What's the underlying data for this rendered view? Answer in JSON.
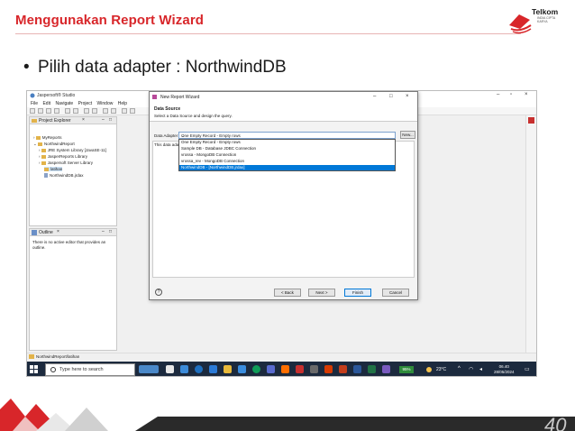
{
  "slide": {
    "title": "Menggunakan Report Wizard",
    "bullet": "Pilih data adapter : NorthwindDB",
    "page_number": "40"
  },
  "logo": {
    "name": "Telkom",
    "subtitle": "INDIA CIPTA KARYA"
  },
  "studio": {
    "app_title": "Jaspersoft® Studio",
    "menu": [
      "File",
      "Edit",
      "Navigate",
      "Project",
      "Window",
      "Help"
    ],
    "project_explorer": {
      "tab": "Project Explorer",
      "items": [
        {
          "label": "MyReports",
          "type": "folder"
        },
        {
          "label": "NorthwindReport",
          "type": "folder"
        },
        {
          "label": "JRE System Library [JavaSE-11]",
          "type": "folder"
        },
        {
          "label": "JasperReports Library",
          "type": "folder"
        },
        {
          "label": "Jaspersoft Server Library",
          "type": "folder"
        },
        {
          "label": "latihan",
          "type": "folder"
        },
        {
          "label": "NorthwindDB.jrdax",
          "type": "file"
        }
      ]
    },
    "outline": {
      "tab": "Outline",
      "message": "There is no active editor that provides an outline."
    },
    "status_path": "NorthwindReport/latihan"
  },
  "dialog": {
    "title": "New Report Wizard",
    "header_title": "Data Source",
    "header_subtitle": "Select a Data Source and design the query.",
    "data_adapter_label": "Data Adapter",
    "selected_adapter": "One Empty Record - Empty rows",
    "new_button": "New...",
    "info_text": "This data adap",
    "options": [
      "One Empty Record - Empty rows",
      "Sample DB - Database JDBC Connection",
      "vrossa - MongoDB Connection",
      "vrossa_rev - MongoDB Connection",
      "NorthwindDB - [NorthwindDB.jrdax]"
    ],
    "highlighted_option_index": 4,
    "buttons": {
      "back": "< Back",
      "next": "Next >",
      "finish": "Finish",
      "cancel": "Cancel"
    }
  },
  "taskbar": {
    "search_placeholder": "Type here to search",
    "battery": "95%",
    "weather": "23°C",
    "time": "06.40",
    "date": "28/05/2024"
  },
  "colors": {
    "title_red": "#d8262a",
    "selection_blue": "#0078d7",
    "taskbar": "#1c2a3e"
  }
}
